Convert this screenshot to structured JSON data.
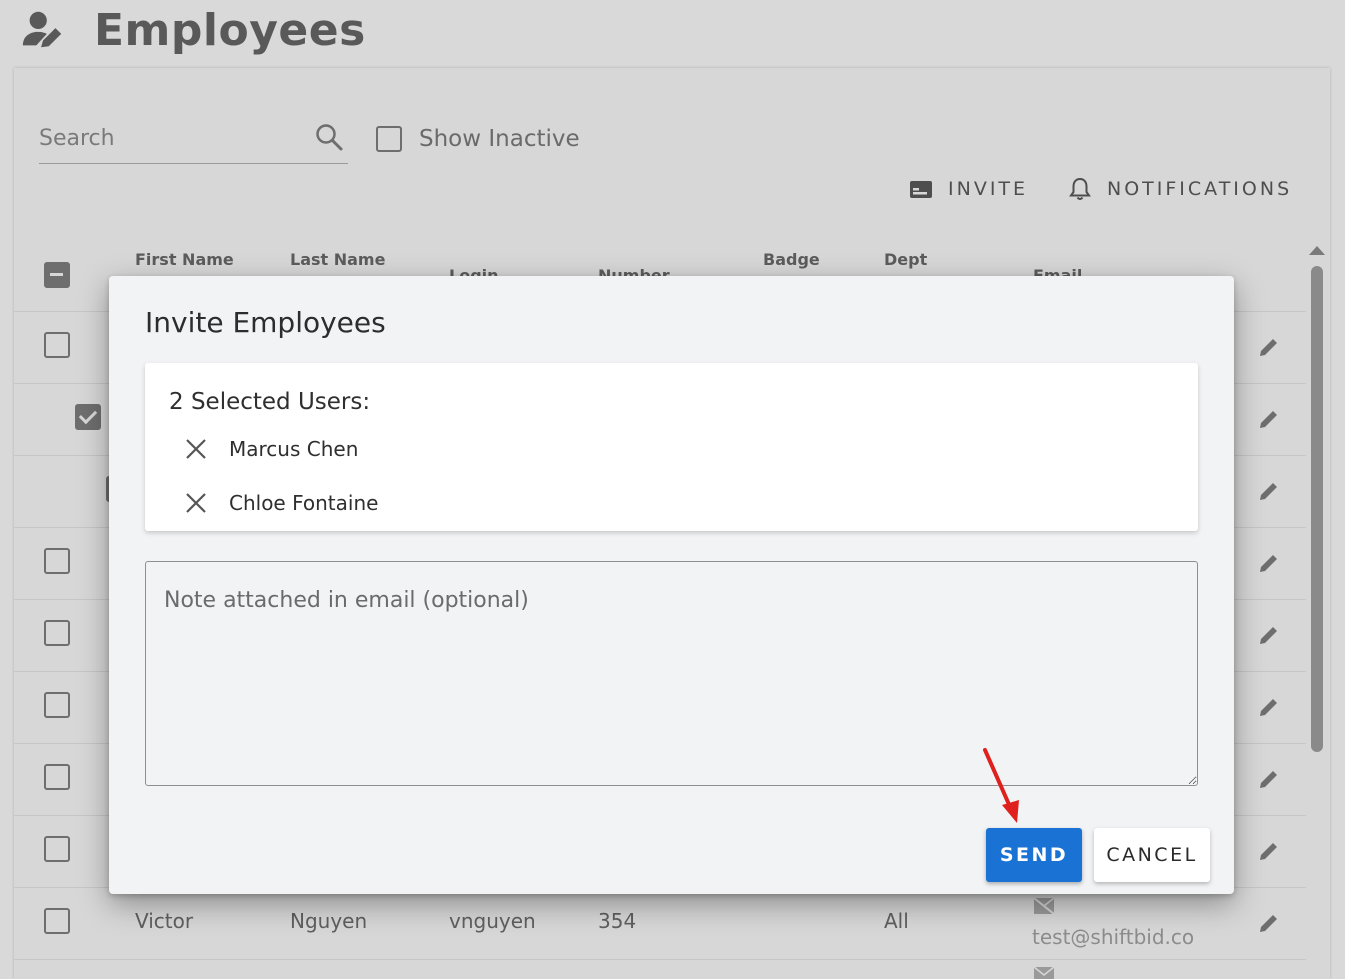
{
  "page": {
    "title": "Employees"
  },
  "search": {
    "placeholder": "Search"
  },
  "filters": {
    "show_inactive_label": "Show Inactive"
  },
  "toolbar": {
    "invite_label": "INVITE",
    "notifications_label": "NOTIFICATIONS"
  },
  "table": {
    "headers": {
      "first_name": "First Name",
      "last_name": "Last Name",
      "login": "Login",
      "number": "Number",
      "badge": "Badge",
      "dept": "Dept",
      "email": "Email"
    },
    "visible_row": {
      "first_name": "Victor",
      "last_name": "Nguyen",
      "login": "vnguyen",
      "number": "354",
      "dept": "All",
      "email": "test@shiftbid.co"
    },
    "row_checked": [
      false,
      true,
      true,
      false,
      false,
      false,
      false,
      false,
      false
    ]
  },
  "modal": {
    "title": "Invite Employees",
    "selected_heading": "2 Selected Users:",
    "selected_users": [
      "Marcus Chen",
      "Chloe Fontaine"
    ],
    "note_placeholder": "Note attached in email (optional)",
    "send_label": "SEND",
    "cancel_label": "CANCEL"
  },
  "colors": {
    "primary": "#1a73d4",
    "annotation_arrow": "#e0201c"
  }
}
